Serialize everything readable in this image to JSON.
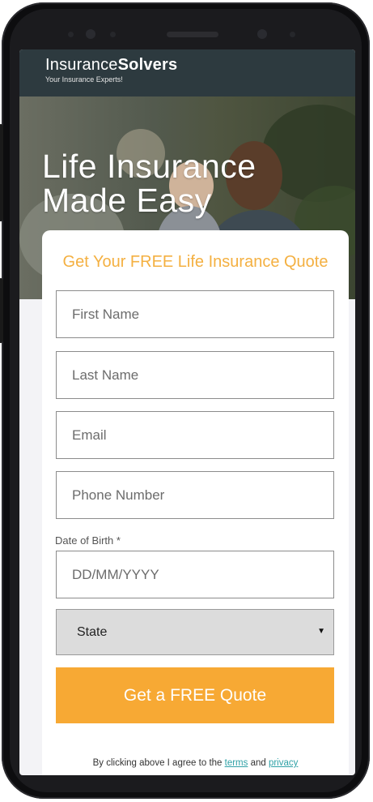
{
  "brand": {
    "name_light": "Insurance",
    "name_bold": "Solvers",
    "tagline": "Your Insurance Experts!"
  },
  "hero": {
    "title_line1": "Life Insurance",
    "title_line2": "Made Easy"
  },
  "form": {
    "heading": "Get Your FREE Life Insurance Quote",
    "first_name_placeholder": "First Name",
    "last_name_placeholder": "Last Name",
    "email_placeholder": "Email",
    "phone_placeholder": "Phone Number",
    "dob_label": "Date of Birth *",
    "dob_placeholder": "DD/MM/YYYY",
    "state_selected": "State",
    "submit_label": "Get a FREE Quote"
  },
  "legal": {
    "prefix": "By clicking above I agree to the ",
    "terms": "terms",
    "and": " and ",
    "privacy": "privacy"
  },
  "colors": {
    "brand_bar": "#2d3a3f",
    "accent_orange": "#f7a934",
    "heading_orange": "#f4b041",
    "link_teal": "#2fa1a6"
  }
}
